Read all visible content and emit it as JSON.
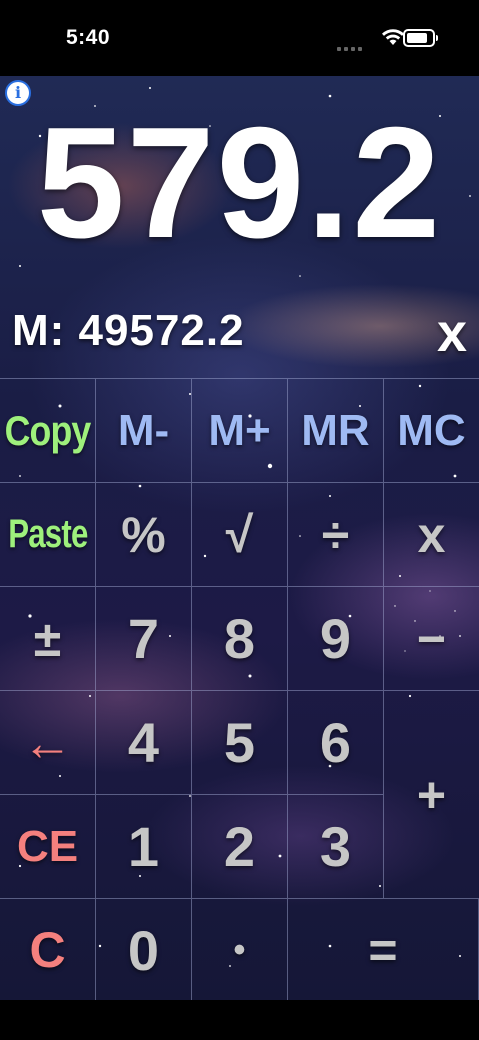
{
  "status_bar": {
    "time": "5:40"
  },
  "display": {
    "value": "579.2",
    "memory_text": "M: 49572.2",
    "close_label": "x"
  },
  "info_icon": "i",
  "keys": {
    "copy": "Copy",
    "m_minus": "M-",
    "m_plus": "M+",
    "mr": "MR",
    "mc": "MC",
    "paste": "Paste",
    "percent": "%",
    "sqrt": "√",
    "divide": "÷",
    "multiply": "x",
    "plus_minus": "±",
    "seven": "7",
    "eight": "8",
    "nine": "9",
    "minus": "−",
    "backspace": "←",
    "four": "4",
    "five": "5",
    "six": "6",
    "plus": "+",
    "ce": "CE",
    "one": "1",
    "two": "2",
    "three": "3",
    "clear": "C",
    "zero": "0",
    "decimal": "•",
    "equals": "="
  },
  "colors": {
    "function_green": "#9ef07c",
    "memory_blue": "#9fbaf3",
    "digit_gray": "#c6c6c6",
    "clear_red": "#f4807e"
  }
}
